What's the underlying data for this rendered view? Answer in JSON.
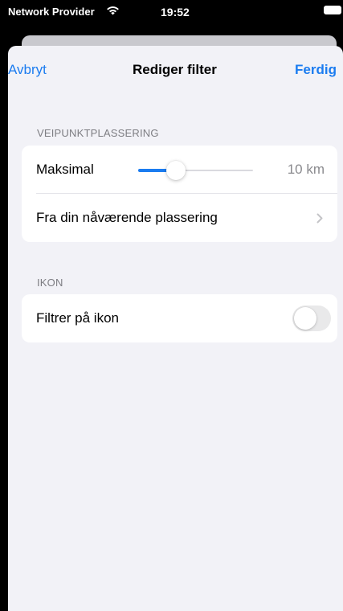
{
  "status_bar": {
    "carrier": "Network Provider",
    "time": "19:52",
    "wifi_icon": "wifi-icon",
    "battery_icon": "battery-icon"
  },
  "nav": {
    "cancel_label": "Avbryt",
    "title": "Rediger filter",
    "done_label": "Ferdig"
  },
  "colors": {
    "accent": "#1b7cf0",
    "background": "#f2f2f7",
    "cell": "#ffffff",
    "secondary_text": "#8a8a8e"
  },
  "waypoint_section": {
    "header": "VEIPUNKTPLASSERING",
    "max_label": "Maksimal",
    "slider_value_text": "10 km",
    "slider_fraction": 0.33,
    "from_location_label": "Fra din nåværende plassering",
    "chevron_icon": "chevron-right-icon"
  },
  "icon_section": {
    "header": "IKON",
    "filter_label": "Filtrer på ikon",
    "toggle_on": false
  }
}
